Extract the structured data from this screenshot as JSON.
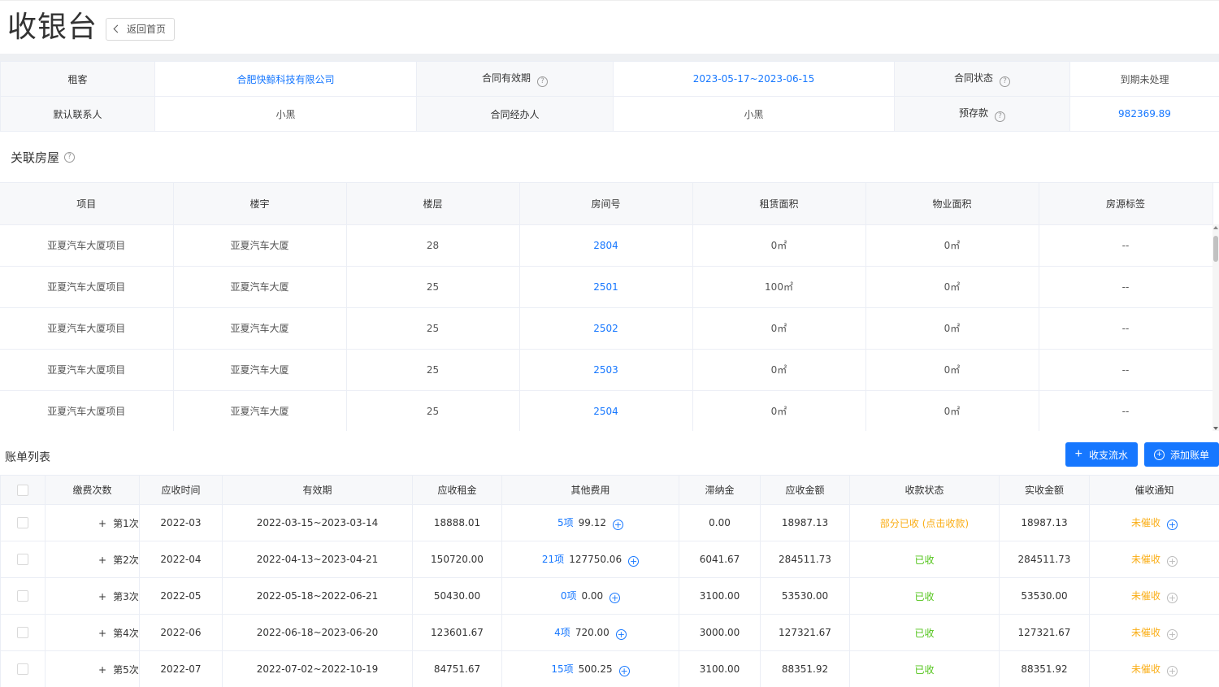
{
  "header": {
    "title": "收银台",
    "back_label": "返回首页"
  },
  "contract_info": {
    "rows": [
      [
        {
          "label": "租客",
          "value": "合肥快鲸科技有限公司",
          "link": true
        },
        {
          "label": "合同有效期",
          "help": true,
          "value": "2023-05-17~2023-06-15",
          "link": true
        },
        {
          "label": "合同状态",
          "help": true,
          "value": "到期未处理",
          "link": false
        }
      ],
      [
        {
          "label": "默认联系人",
          "value": "小黑",
          "link": false
        },
        {
          "label": "合同经办人",
          "value": "小黑",
          "link": false
        },
        {
          "label": "预存款",
          "help": true,
          "value": "982369.89",
          "link": true
        }
      ]
    ]
  },
  "rooms": {
    "title": "关联房屋",
    "columns": [
      "项目",
      "楼宇",
      "楼层",
      "房间号",
      "租赁面积",
      "物业面积",
      "房源标签"
    ],
    "rows": [
      [
        "亚夏汽车大厦项目",
        "亚夏汽车大厦",
        "28",
        "2804",
        "0㎡",
        "0㎡",
        "--"
      ],
      [
        "亚夏汽车大厦项目",
        "亚夏汽车大厦",
        "25",
        "2501",
        "100㎡",
        "0㎡",
        "--"
      ],
      [
        "亚夏汽车大厦项目",
        "亚夏汽车大厦",
        "25",
        "2502",
        "0㎡",
        "0㎡",
        "--"
      ],
      [
        "亚夏汽车大厦项目",
        "亚夏汽车大厦",
        "25",
        "2503",
        "0㎡",
        "0㎡",
        "--"
      ],
      [
        "亚夏汽车大厦项目",
        "亚夏汽车大厦",
        "25",
        "2504",
        "0㎡",
        "0㎡",
        "--"
      ]
    ]
  },
  "bills": {
    "title": "账单列表",
    "flow_button": "收支流水",
    "add_button": "添加账单",
    "columns": [
      "缴费次数",
      "应收时间",
      "有效期",
      "应收租金",
      "其他费用",
      "滞纳金",
      "应收金额",
      "收款状态",
      "实收金额",
      "催收通知"
    ],
    "rows": [
      {
        "times": "第1次",
        "month": "2022-03",
        "period": "2022-03-15~2023-03-14",
        "rent": "18888.01",
        "other_count": "5项",
        "other_amount": "99.12",
        "late": "0.00",
        "due": "18987.13",
        "status": "部分已收 (点击收款)",
        "status_type": "partial",
        "received": "18987.13",
        "notice": "未催收",
        "notice_active": true
      },
      {
        "times": "第2次",
        "month": "2022-04",
        "period": "2022-04-13~2023-04-21",
        "rent": "150720.00",
        "other_count": "21项",
        "other_amount": "127750.06",
        "late": "6041.67",
        "due": "284511.73",
        "status": "已收",
        "status_type": "done",
        "received": "284511.73",
        "notice": "未催收",
        "notice_active": false
      },
      {
        "times": "第3次",
        "month": "2022-05",
        "period": "2022-05-18~2022-06-21",
        "rent": "50430.00",
        "other_count": "0项",
        "other_amount": "0.00",
        "late": "3100.00",
        "due": "53530.00",
        "status": "已收",
        "status_type": "done",
        "received": "53530.00",
        "notice": "未催收",
        "notice_active": false
      },
      {
        "times": "第4次",
        "month": "2022-06",
        "period": "2022-06-18~2023-06-20",
        "rent": "123601.67",
        "other_count": "4项",
        "other_amount": "720.00",
        "late": "3000.00",
        "due": "127321.67",
        "status": "已收",
        "status_type": "done",
        "received": "127321.67",
        "notice": "未催收",
        "notice_active": false
      },
      {
        "times": "第5次",
        "month": "2022-07",
        "period": "2022-07-02~2022-10-19",
        "rent": "84751.67",
        "other_count": "15项",
        "other_amount": "500.25",
        "late": "3100.00",
        "due": "88351.92",
        "status": "已收",
        "status_type": "done",
        "received": "88351.92",
        "notice": "未催收",
        "notice_active": false
      }
    ]
  },
  "colors": {
    "link": "#1677ff",
    "success": "#52c41a",
    "warning": "#faad14",
    "header_bg": "#f7f8fa"
  }
}
